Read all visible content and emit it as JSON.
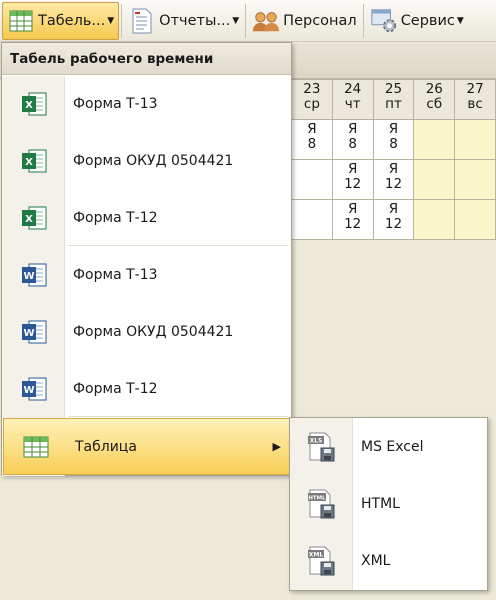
{
  "toolbar": {
    "items": [
      {
        "label": "Табель",
        "suffix": "...",
        "icon": "table-icon"
      },
      {
        "label": "Отчеты",
        "suffix": "...",
        "icon": "report-icon"
      },
      {
        "label": "Персонал",
        "suffix": "",
        "icon": "people-icon"
      },
      {
        "label": "Сервис",
        "suffix": "",
        "icon": "gear-icon"
      }
    ]
  },
  "grid": {
    "days": [
      {
        "num": "23",
        "dow": "ср",
        "weekend": false
      },
      {
        "num": "24",
        "dow": "чт",
        "weekend": false
      },
      {
        "num": "25",
        "dow": "пт",
        "weekend": false
      },
      {
        "num": "26",
        "dow": "сб",
        "weekend": true
      },
      {
        "num": "27",
        "dow": "вс",
        "weekend": true
      }
    ],
    "rows": [
      [
        {
          "code": "Я",
          "hours": "8"
        },
        {
          "code": "Я",
          "hours": "8"
        },
        {
          "code": "Я",
          "hours": "8"
        },
        {
          "code": "",
          "hours": ""
        },
        {
          "code": "",
          "hours": ""
        }
      ],
      [
        {
          "code": "",
          "hours": ""
        },
        {
          "code": "Я",
          "hours": "12"
        },
        {
          "code": "Я",
          "hours": "12"
        },
        {
          "code": "",
          "hours": ""
        },
        {
          "code": "",
          "hours": ""
        }
      ],
      [
        {
          "code": "",
          "hours": ""
        },
        {
          "code": "Я",
          "hours": "12"
        },
        {
          "code": "Я",
          "hours": "12"
        },
        {
          "code": "",
          "hours": ""
        },
        {
          "code": "",
          "hours": ""
        }
      ]
    ]
  },
  "menu": {
    "title": "Табель рабочего времени",
    "items": [
      {
        "label": "Форма Т-13",
        "icon": "excel-icon"
      },
      {
        "label": "Форма ОКУД 0504421",
        "icon": "excel-icon"
      },
      {
        "label": "Форма Т-12",
        "icon": "excel-icon"
      },
      {
        "label": "Форма Т-13",
        "icon": "word-icon"
      },
      {
        "label": "Форма ОКУД 0504421",
        "icon": "word-icon"
      },
      {
        "label": "Форма Т-12",
        "icon": "word-icon"
      },
      {
        "label": "Таблица",
        "icon": "table-icon"
      }
    ]
  },
  "submenu": {
    "items": [
      {
        "label": "MS Excel",
        "badge": "XLS",
        "icon": "xls-save-icon"
      },
      {
        "label": "HTML",
        "badge": "HTML",
        "icon": "html-save-icon"
      },
      {
        "label": "XML",
        "badge": "XML",
        "icon": "xml-save-icon"
      }
    ]
  },
  "colors": {
    "highlight_top": "#fff1b8",
    "highlight_bottom": "#f8cf57",
    "excel_green": "#1f7a45",
    "word_blue": "#2b5797",
    "weekend_cell": "#fbf6c9"
  }
}
